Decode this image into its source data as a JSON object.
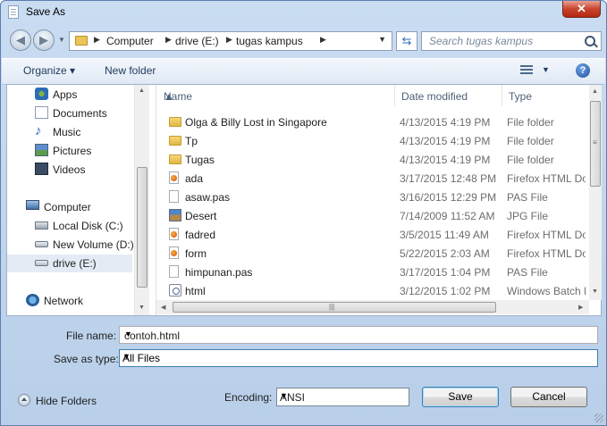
{
  "window": {
    "title": "Save As",
    "close_label": "✕"
  },
  "address_bar": {
    "breadcrumbs": [
      "Computer",
      "drive (E:)",
      "tugas kampus"
    ],
    "search_placeholder": "Search tugas kampus"
  },
  "toolbar": {
    "organize_label": "Organize ▾",
    "new_folder_label": "New folder",
    "help_label": "?"
  },
  "sidebar": {
    "items": [
      {
        "label": "Apps",
        "icon": "apps-icon"
      },
      {
        "label": "Documents",
        "icon": "documents-icon"
      },
      {
        "label": "Music",
        "icon": "music-icon"
      },
      {
        "label": "Pictures",
        "icon": "pictures-icon"
      },
      {
        "label": "Videos",
        "icon": "videos-icon"
      },
      {
        "label": "Computer",
        "icon": "computer-icon"
      },
      {
        "label": "Local Disk (C:)",
        "icon": "disk-icon"
      },
      {
        "label": "New Volume (D:)",
        "icon": "drive-icon"
      },
      {
        "label": "drive (E:)",
        "icon": "drive-icon",
        "selected": true
      },
      {
        "label": "Network",
        "icon": "network-icon"
      }
    ]
  },
  "file_list": {
    "columns": [
      "Name",
      "Date modified",
      "Type"
    ],
    "rows": [
      {
        "name": "Olga & Billy Lost in Singapore",
        "date": "4/13/2015 4:19 PM",
        "type": "File folder",
        "icon": "folder-icon"
      },
      {
        "name": "Tp",
        "date": "4/13/2015 4:19 PM",
        "type": "File folder",
        "icon": "folder-icon"
      },
      {
        "name": "Tugas",
        "date": "4/13/2015 4:19 PM",
        "type": "File folder",
        "icon": "folder-icon"
      },
      {
        "name": "ada",
        "date": "3/17/2015 12:48 PM",
        "type": "Firefox HTML Document",
        "icon": "firefox-html-icon"
      },
      {
        "name": "asaw.pas",
        "date": "3/16/2015 12:29 PM",
        "type": "PAS File",
        "icon": "file-icon"
      },
      {
        "name": "Desert",
        "date": "7/14/2009 11:52 AM",
        "type": "JPG File",
        "icon": "image-icon"
      },
      {
        "name": "fadred",
        "date": "3/5/2015 11:49 AM",
        "type": "Firefox HTML Document",
        "icon": "firefox-html-icon"
      },
      {
        "name": "form",
        "date": "5/22/2015 2:03 AM",
        "type": "Firefox HTML Document",
        "icon": "firefox-html-icon"
      },
      {
        "name": "himpunan.pas",
        "date": "3/17/2015 1:04 PM",
        "type": "PAS File",
        "icon": "file-icon"
      },
      {
        "name": "html",
        "date": "3/12/2015 1:02 PM",
        "type": "Windows Batch File",
        "icon": "batch-file-icon"
      }
    ]
  },
  "form": {
    "file_name_label": "File name:",
    "file_name_value": "contoh.html",
    "save_type_label": "Save as type:",
    "save_type_value": "All Files"
  },
  "footer": {
    "hide_folders_label": "Hide Folders",
    "encoding_label": "Encoding:",
    "encoding_value": "ANSI",
    "save_label": "Save",
    "cancel_label": "Cancel"
  }
}
